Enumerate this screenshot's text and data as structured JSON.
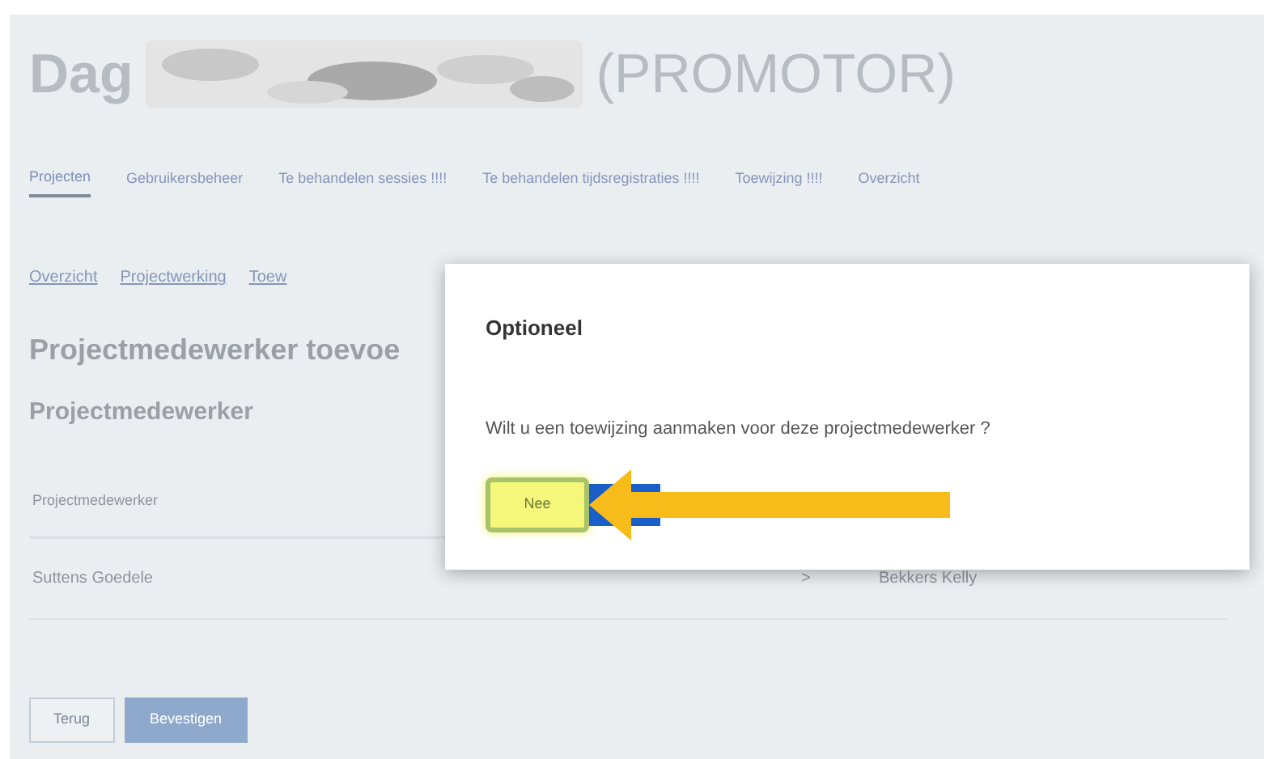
{
  "header": {
    "greeting": "Dag",
    "role": "(PROMOTOR)"
  },
  "tabs": [
    {
      "label": "Projecten",
      "selected": true
    },
    {
      "label": "Gebruikersbeheer",
      "selected": false
    },
    {
      "label": "Te behandelen sessies !!!!",
      "selected": false
    },
    {
      "label": "Te behandelen tijdsregistraties !!!!",
      "selected": false
    },
    {
      "label": "Toewijzing !!!!",
      "selected": false
    },
    {
      "label": "Overzicht",
      "selected": false
    }
  ],
  "breadcrumbs": [
    "Overzicht",
    "Projectwerking",
    "Toew"
  ],
  "page_title": "Projectmedewerker toevoe",
  "section_title": "Projectmedewerker",
  "table": {
    "columns": [
      "Projectmedewerker"
    ],
    "rows": [
      {
        "name": "Suttens Goedele",
        "chevron": ">",
        "assignee": "Bekkers Kelly"
      }
    ]
  },
  "buttons": [
    {
      "label": "Terug",
      "kind": "secondary"
    },
    {
      "label": "Bevestigen",
      "kind": "primary"
    }
  ],
  "dialog": {
    "title": "Optioneel",
    "message": "Wilt u een toewijzing aanmaken voor deze projectmedewerker ?",
    "button": "Nee"
  }
}
